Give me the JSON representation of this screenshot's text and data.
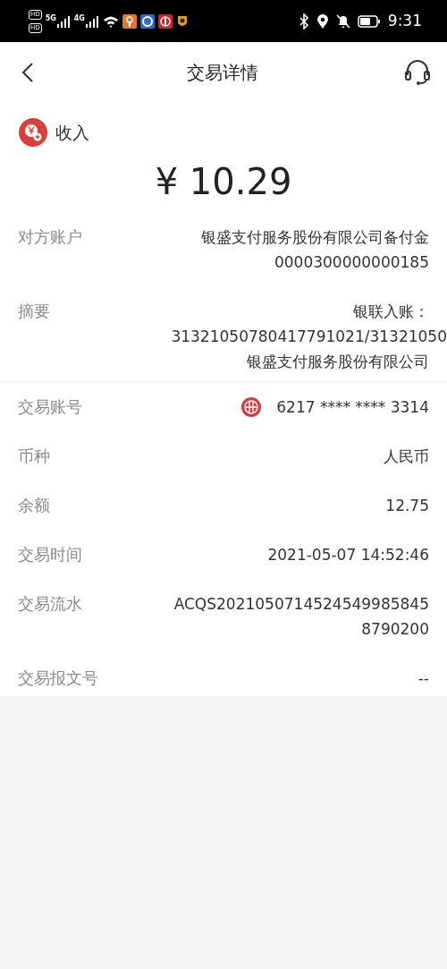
{
  "status_bar": {
    "badges": [
      "HD",
      "HD"
    ],
    "networks": [
      "5G",
      "4G"
    ],
    "time": "9:31"
  },
  "header": {
    "title": "交易详情"
  },
  "type_label": "收入",
  "amount": "¥ 10.29",
  "sections": [
    {
      "rows": [
        {
          "kind": "text",
          "label": "对方账户",
          "lines": [
            "银盛支付服务股份有限公司备付金",
            "0000300000000185"
          ]
        },
        {
          "kind": "cut",
          "label": "摘要",
          "lines": [
            "银联入账：",
            "31321050780417791021/31321050",
            "银盛支付服务股份有限公司"
          ]
        }
      ]
    },
    {
      "rows": [
        {
          "kind": "card",
          "label": "交易账号",
          "lines": [
            "6217 **** **** 3314"
          ]
        },
        {
          "kind": "text",
          "label": "币种",
          "lines": [
            "人民币"
          ]
        },
        {
          "kind": "text",
          "label": "余额",
          "lines": [
            "12.75"
          ]
        },
        {
          "kind": "text",
          "label": "交易时间",
          "lines": [
            "2021-05-07 14:52:46"
          ]
        },
        {
          "kind": "text",
          "label": "交易流水",
          "lines": [
            "ACQS2021050714524549985845",
            "8790200"
          ]
        },
        {
          "kind": "text",
          "label": "交易报文号",
          "lines": [
            "--"
          ]
        }
      ]
    }
  ]
}
